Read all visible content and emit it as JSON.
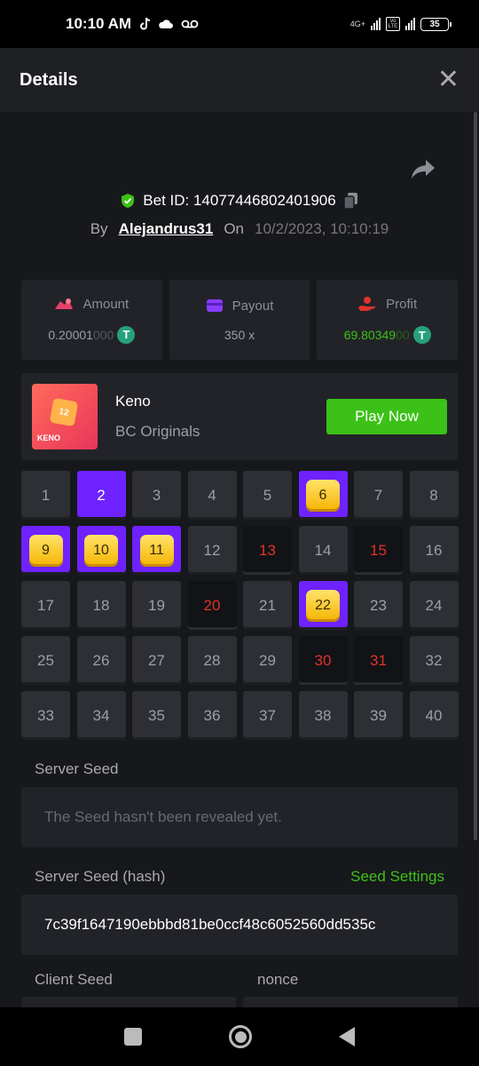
{
  "status_bar": {
    "time": "10:10 AM",
    "network": "4G+",
    "volte": "Vo LTE",
    "battery": "35"
  },
  "header": {
    "title": "Details",
    "close_icon": "close-icon"
  },
  "bet": {
    "id_label": "Bet ID: 14077446802401906",
    "by_label": "By",
    "user": "Alejandrus31",
    "on_label": "On",
    "date": "10/2/2023, 10:10:19"
  },
  "stats": {
    "amount": {
      "label": "Amount",
      "value_main": "0.20001",
      "value_dim": "000",
      "icon": "amount-icon"
    },
    "payout": {
      "label": "Payout",
      "value": "350 x",
      "icon": "wallet-icon"
    },
    "profit": {
      "label": "Profit",
      "value_main": "69.80349",
      "value_dim": "00",
      "icon": "profit-icon"
    },
    "coin_symbol": "T"
  },
  "game": {
    "name": "Keno",
    "provider": "BC Originals",
    "play_label": "Play Now",
    "thumb_number": "12",
    "thumb_tag": "KENO"
  },
  "board": [
    {
      "n": "1",
      "state": "normal"
    },
    {
      "n": "2",
      "state": "selected"
    },
    {
      "n": "3",
      "state": "normal"
    },
    {
      "n": "4",
      "state": "normal"
    },
    {
      "n": "5",
      "state": "normal"
    },
    {
      "n": "6",
      "state": "hit"
    },
    {
      "n": "7",
      "state": "normal"
    },
    {
      "n": "8",
      "state": "normal"
    },
    {
      "n": "9",
      "state": "hit"
    },
    {
      "n": "10",
      "state": "hit"
    },
    {
      "n": "11",
      "state": "hit"
    },
    {
      "n": "12",
      "state": "normal"
    },
    {
      "n": "13",
      "state": "miss"
    },
    {
      "n": "14",
      "state": "normal"
    },
    {
      "n": "15",
      "state": "miss"
    },
    {
      "n": "16",
      "state": "normal"
    },
    {
      "n": "17",
      "state": "normal"
    },
    {
      "n": "18",
      "state": "normal"
    },
    {
      "n": "19",
      "state": "normal"
    },
    {
      "n": "20",
      "state": "miss"
    },
    {
      "n": "21",
      "state": "normal"
    },
    {
      "n": "22",
      "state": "hit"
    },
    {
      "n": "23",
      "state": "normal"
    },
    {
      "n": "24",
      "state": "normal"
    },
    {
      "n": "25",
      "state": "normal"
    },
    {
      "n": "26",
      "state": "normal"
    },
    {
      "n": "27",
      "state": "normal"
    },
    {
      "n": "28",
      "state": "normal"
    },
    {
      "n": "29",
      "state": "normal"
    },
    {
      "n": "30",
      "state": "miss"
    },
    {
      "n": "31",
      "state": "miss"
    },
    {
      "n": "32",
      "state": "normal"
    },
    {
      "n": "33",
      "state": "normal"
    },
    {
      "n": "34",
      "state": "normal"
    },
    {
      "n": "35",
      "state": "normal"
    },
    {
      "n": "36",
      "state": "normal"
    },
    {
      "n": "37",
      "state": "normal"
    },
    {
      "n": "38",
      "state": "normal"
    },
    {
      "n": "39",
      "state": "normal"
    },
    {
      "n": "40",
      "state": "normal"
    }
  ],
  "seeds": {
    "server_label": "Server Seed",
    "server_value": "The Seed hasn't been revealed yet.",
    "hash_label": "Server Seed (hash)",
    "settings_link": "Seed Settings",
    "hash_value": "7c39f1647190ebbbd81be0ccf48c6052560dd535c",
    "client_label": "Client Seed",
    "nonce_label": "nonce"
  },
  "colors": {
    "accent_green": "#3bc117",
    "selected_purple": "#6e22ff",
    "miss_red": "#e0322d"
  }
}
